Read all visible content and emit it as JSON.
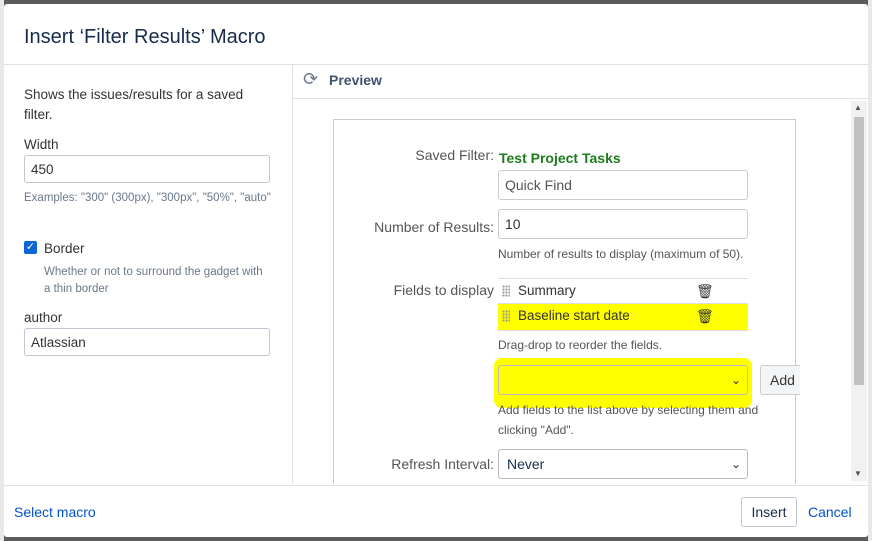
{
  "dialog": {
    "title": "Insert ‘Filter Results’ Macro"
  },
  "params": {
    "description": "Shows the issues/results for a saved filter.",
    "width_label": "Width",
    "width_value": "450",
    "width_hint": "Examples: \"300\" (300px), \"300px\", \"50%\", \"auto\"",
    "border_label": "Border",
    "border_checked": true,
    "border_hint": "Whether or not to surround the gadget with a thin border",
    "author_label": "author",
    "author_value": "Atlassian"
  },
  "preview": {
    "label": "Preview",
    "saved_filter_label": "Saved Filter:",
    "saved_filter_value": "Test Project Tasks",
    "quick_find_placeholder": "Quick Find",
    "num_results_label": "Number of Results:",
    "num_results_value": "10",
    "num_results_hint": "Number of results to display (maximum of 50).",
    "fields_label": "Fields to display",
    "fields": [
      {
        "name": "Summary",
        "highlighted": false
      },
      {
        "name": "Baseline start date",
        "highlighted": true
      }
    ],
    "reorder_hint": "Drag-drop to reorder the fields.",
    "add_select_value": "",
    "add_button": "Add",
    "add_hint": "Add fields to the list above by selecting them and clicking \"Add\".",
    "refresh_label": "Refresh Interval:",
    "refresh_value": "Never"
  },
  "footer": {
    "select_macro": "Select macro",
    "insert": "Insert",
    "cancel": "Cancel"
  },
  "colors": {
    "accent": "#0052cc",
    "filter_green": "#1e7b1e",
    "highlight": "#ffff00"
  }
}
